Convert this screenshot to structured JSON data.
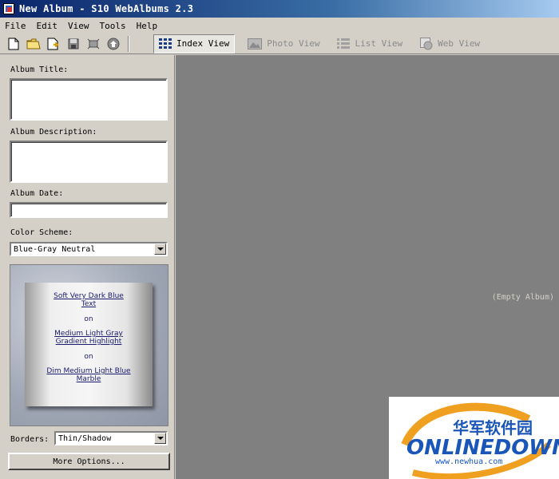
{
  "window": {
    "title": "New Album - S10 WebAlbums 2.3"
  },
  "menu": [
    "File",
    "Edit",
    "View",
    "Tools",
    "Help"
  ],
  "toolbar": {
    "icons": [
      "new-document-icon",
      "open-folder-icon",
      "add-page-icon",
      "save-icon",
      "fit-view-icon",
      "upload-icon"
    ],
    "views": [
      {
        "label": "Index View",
        "icon": "grid-icon",
        "active": true
      },
      {
        "label": "Photo View",
        "icon": "photo-icon",
        "active": false
      },
      {
        "label": "List View",
        "icon": "list-icon",
        "active": false
      },
      {
        "label": "Web View",
        "icon": "web-icon",
        "active": false
      }
    ]
  },
  "form": {
    "album_title_label": "Album Title:",
    "album_title_value": "",
    "album_description_label": "Album Description:",
    "album_description_value": "",
    "album_date_label": "Album Date:",
    "album_date_value": "",
    "color_scheme_label": "Color Scheme:",
    "color_scheme_value": "Blue-Gray Neutral",
    "borders_label": "Borders:",
    "borders_value": "Thin/Shadow",
    "more_options_label": "More Options..."
  },
  "preview": {
    "text_line1": "Soft Very Dark Blue",
    "text_line2": "Text",
    "on1": "on",
    "highlight_line1": "Medium Light Gray",
    "highlight_line2": "Gradient Highlight",
    "on2": "on",
    "background_line1": "Dim Medium Light Blue",
    "background_line2": "Marble"
  },
  "main": {
    "empty_text": "(Empty Album)"
  },
  "watermark": {
    "brand_cn": "华军软件园",
    "brand": "ONLINEDOWN",
    "url": "www.newhua.com"
  },
  "colors": {
    "main_bg": "#808080",
    "panel_bg": "#d4d0c8",
    "title_bar": "#0a246a",
    "brand_blue": "#1a56b8",
    "brand_orange": "#f0a020"
  }
}
